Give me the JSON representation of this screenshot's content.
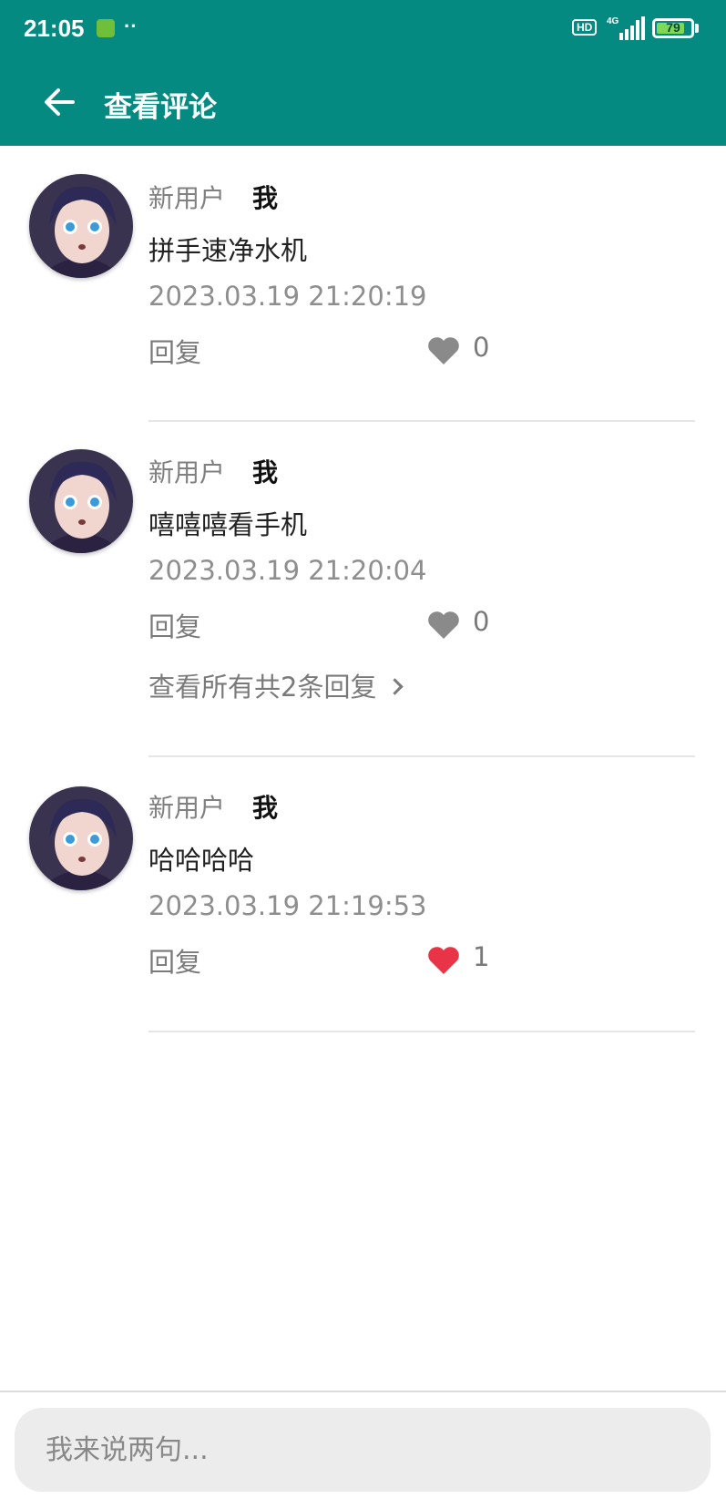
{
  "status_bar": {
    "time": "21:05",
    "dots": "··",
    "hd_label": "HD",
    "network": "4G",
    "battery": "79"
  },
  "header": {
    "title": "查看评论",
    "back_icon": "arrow-left-icon"
  },
  "comments": [
    {
      "username": "新用户",
      "tag": "我",
      "content": "拼手速净水机",
      "time": "2023.03.19 21:20:19",
      "reply_label": "回复",
      "likes": "0",
      "liked": false
    },
    {
      "username": "新用户",
      "tag": "我",
      "content": "嘻嘻嘻看手机",
      "time": "2023.03.19 21:20:04",
      "reply_label": "回复",
      "likes": "0",
      "liked": false,
      "view_replies": "查看所有共2条回复"
    },
    {
      "username": "新用户",
      "tag": "我",
      "content": "哈哈哈哈",
      "time": "2023.03.19 21:19:53",
      "reply_label": "回复",
      "likes": "1",
      "liked": true
    }
  ],
  "input": {
    "placeholder": "我来说两句..."
  },
  "colors": {
    "primary": "#058a82",
    "heart_gray": "#8a8a8a",
    "heart_red": "#e83446"
  }
}
